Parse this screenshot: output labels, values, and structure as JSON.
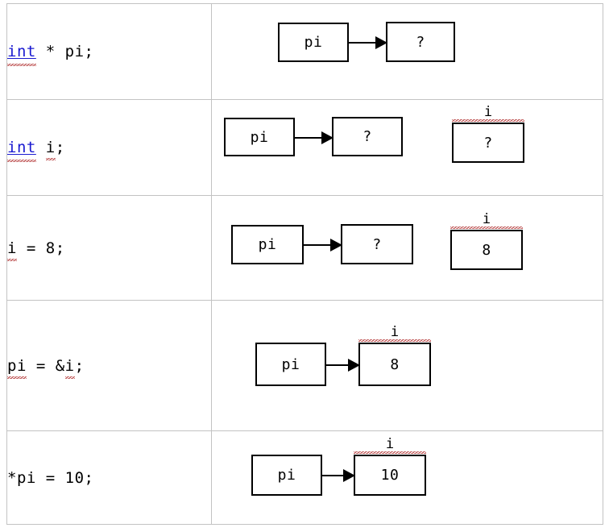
{
  "document": {
    "title": "Pointer declaration and assignment memory diagrams",
    "type": "table",
    "rows_count": 5,
    "columns_count": 2,
    "colors": {
      "grid_border": "#c3c3c3",
      "keyword_blue": "#1a1ad0",
      "spellcheck_red": "#b03030",
      "box_border": "#000000",
      "text": "#000000",
      "background": "#ffffff"
    }
  },
  "rows": [
    {
      "id": "row-1",
      "code": {
        "keyword": "int",
        "rest": " * pi;",
        "full_text": "int * pi;",
        "keyword_spellchecked": true
      },
      "diagram": {
        "pointer_box": {
          "label": "pi"
        },
        "arrow": {
          "from": "pi",
          "to": "target",
          "present": true
        },
        "target_box": {
          "value": "?",
          "name_label": ""
        },
        "extra_box": null
      }
    },
    {
      "id": "row-2",
      "code": {
        "keyword": "int",
        "rest": " i;",
        "full_text": "int i;",
        "keyword_spellchecked": true
      },
      "diagram": {
        "pointer_box": {
          "label": "pi"
        },
        "arrow": {
          "from": "pi",
          "to": "target",
          "present": true
        },
        "target_box": {
          "value": "?",
          "name_label": ""
        },
        "extra_box": {
          "name_label": "i",
          "value": "?"
        }
      }
    },
    {
      "id": "row-3",
      "code": {
        "keyword": "",
        "rest": "i = 8;",
        "full_text": "i = 8;",
        "keyword_spellchecked": false
      },
      "diagram": {
        "pointer_box": {
          "label": "pi"
        },
        "arrow": {
          "from": "pi",
          "to": "target",
          "present": true
        },
        "target_box": {
          "value": "?",
          "name_label": ""
        },
        "extra_box": {
          "name_label": "i",
          "value": "8"
        }
      }
    },
    {
      "id": "row-4",
      "code": {
        "keyword": "",
        "rest": "pi = &i;",
        "full_text": "pi = &i;",
        "keyword_spellchecked": false
      },
      "diagram": {
        "pointer_box": {
          "label": "pi"
        },
        "arrow": {
          "from": "pi",
          "to": "target",
          "present": true
        },
        "target_box": {
          "value": "8",
          "name_label": "i"
        },
        "extra_box": null
      }
    },
    {
      "id": "row-5",
      "code": {
        "keyword": "",
        "rest": "*pi = 10;",
        "full_text": "*pi = 10;",
        "keyword_spellchecked": false
      },
      "diagram": {
        "pointer_box": {
          "label": "pi"
        },
        "arrow": {
          "from": "pi",
          "to": "target",
          "present": true
        },
        "target_box": {
          "value": "10",
          "name_label": "i"
        },
        "extra_box": null
      }
    }
  ]
}
